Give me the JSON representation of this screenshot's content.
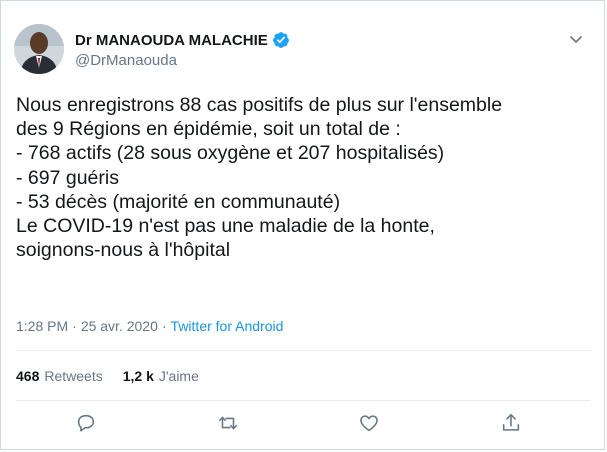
{
  "colors": {
    "accent": "#1b95e0",
    "verified": "#1da1f2",
    "muted": "#657786",
    "text": "#14171a",
    "divider": "#e6ecf0"
  },
  "user": {
    "display_name": "Dr MANAOUDA MALACHIE",
    "handle": "@DrManaouda",
    "verified": true
  },
  "tweet": {
    "text": "Nous enregistrons 88 cas positifs de plus sur l'ensemble\ndes 9 Régions en épidémie, soit un total de :\n- 768 actifs (28 sous oxygène et 207 hospitalisés)\n- 697 guéris\n- 53 décès (majorité en communauté)\nLe COVID-19 n'est pas une maladie de la honte,\nsoignons-nous à l'hôpital"
  },
  "meta": {
    "time": "1:28 PM",
    "separator": "·",
    "date": "25 avr. 2020",
    "source": "Twitter for Android"
  },
  "stats": {
    "retweets_count": "468",
    "retweets_label": "Retweets",
    "likes_count": "1,2 k",
    "likes_label": "J'aime"
  },
  "icons": {
    "reply": "reply-icon",
    "retweet": "retweet-icon",
    "like": "heart-icon",
    "share": "share-icon",
    "caret": "chevron-down-icon",
    "verified": "verified-badge-icon"
  }
}
